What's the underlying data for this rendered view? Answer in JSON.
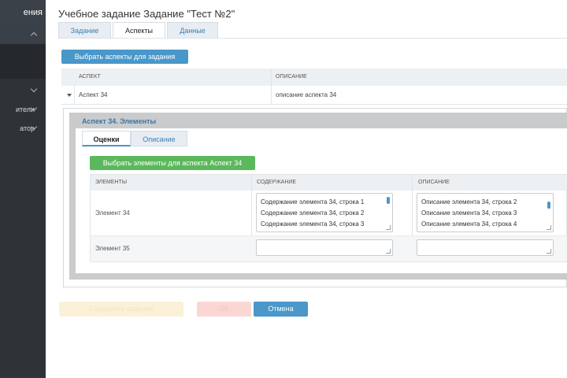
{
  "sidebar": {
    "top_label": "ения",
    "items": [
      {
        "label": ""
      },
      {
        "label": "ители"
      },
      {
        "label": "атор"
      }
    ]
  },
  "page": {
    "title": "Учебное задание Задание \"Тест №2\"",
    "tabs": [
      {
        "label": "Задание"
      },
      {
        "label": "Аспекты"
      },
      {
        "label": "Данные"
      }
    ],
    "active_tab": "Аспекты"
  },
  "aspects": {
    "select_button": "Выбрать аспекты для задания",
    "columns": [
      "АСПЕКТ",
      "ОПИСАНИЕ"
    ],
    "rows": [
      {
        "aspect": "Аспект 34",
        "description": "описание аспекта 34"
      }
    ]
  },
  "elements_panel": {
    "title": "Аспект 34. Элементы",
    "tabs": [
      {
        "label": "Оценки"
      },
      {
        "label": "Описание"
      }
    ],
    "select_button": "Выбрать элементы для аспекта Аспект 34",
    "columns": [
      "ЭЛЕМЕНТЫ",
      "СОДЕРЖАНИЕ",
      "ОПИСАНИЕ"
    ],
    "rows": [
      {
        "name": "Элемент 34",
        "content": [
          "Содержание элемента 34, строка 1",
          "Содержание элемента 34, строка 2",
          "Содержание элемента 34, строка 3"
        ],
        "description": [
          "Описание элемента 34, строка 2",
          "Описание элемента 34, строка 3",
          "Описание элемента 34, строка 4"
        ]
      },
      {
        "name": "Элемент 35",
        "content": [],
        "description": []
      }
    ]
  },
  "footer": {
    "save_label": "Сохранить задание",
    "ok_label": "OK",
    "cancel_label": "Отмена"
  },
  "colors": {
    "primary": "#4a97c9",
    "success": "#5cb85c",
    "sidebar": "#2e3338"
  }
}
